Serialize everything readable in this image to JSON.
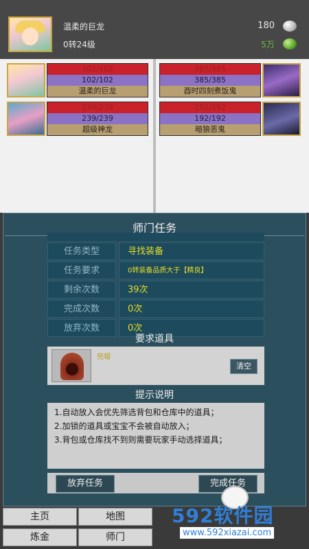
{
  "header": {
    "player_name": "温柔的巨龙",
    "level": "0转24级",
    "silver": "180",
    "jade": "5万",
    "silver_icon": "silver-coin-icon",
    "jade_icon": "jade-coin-icon"
  },
  "battle": {
    "left_units": [
      {
        "hp": "102/102",
        "mp": "102/102",
        "name": "温柔的巨龙",
        "icon": "elf-girl-portrait"
      },
      {
        "hp": "239/239",
        "mp": "239/239",
        "name": "超级神龙",
        "icon": "dragon-portrait"
      }
    ],
    "right_units": [
      {
        "hp": "385/385",
        "mp": "385/385",
        "name": "酉时四刻煮饭鬼",
        "icon": "purple-ghost-portrait"
      },
      {
        "hp": "192/192",
        "mp": "192/192",
        "name": "暗狼恶鬼",
        "icon": "dark-wolf-portrait"
      }
    ]
  },
  "dialog": {
    "title": "师门任务",
    "rows": [
      {
        "label": "任务类型",
        "value": "寻找装备"
      },
      {
        "label": "任务要求",
        "value": "0转装备品质大于【精良】"
      },
      {
        "label": "剩余次数",
        "value": "39次"
      },
      {
        "label": "完成次数",
        "value": "0次"
      },
      {
        "label": "放弃次数",
        "value": "0次"
      }
    ],
    "required_title": "要求道具",
    "item_name": "兜帽",
    "clear_label": "清空",
    "hint_title": "提示说明",
    "hints": [
      "1.自动放入会优先筛选背包和仓库中的道具；",
      "2.加锁的道具或宝宝不会被自动放入；",
      "3.背包或仓库找不到则需要玩家手动选择道具；"
    ],
    "abandon_label": "放弃任务",
    "complete_label": "完成任务"
  },
  "nav": {
    "items": [
      "主页",
      "地图",
      "炼金",
      "师门"
    ]
  },
  "watermark": {
    "brand": "592软件园",
    "url": "www.592xiazai.com"
  },
  "colors": {
    "hp_red": "#c9222a",
    "mp_purple": "#8b72c4",
    "name_tan": "#b89f72",
    "dialog_bg": "#2c4f5e",
    "value_yellow": "#e6df2c",
    "watermark_blue": "#2f7fd6"
  }
}
